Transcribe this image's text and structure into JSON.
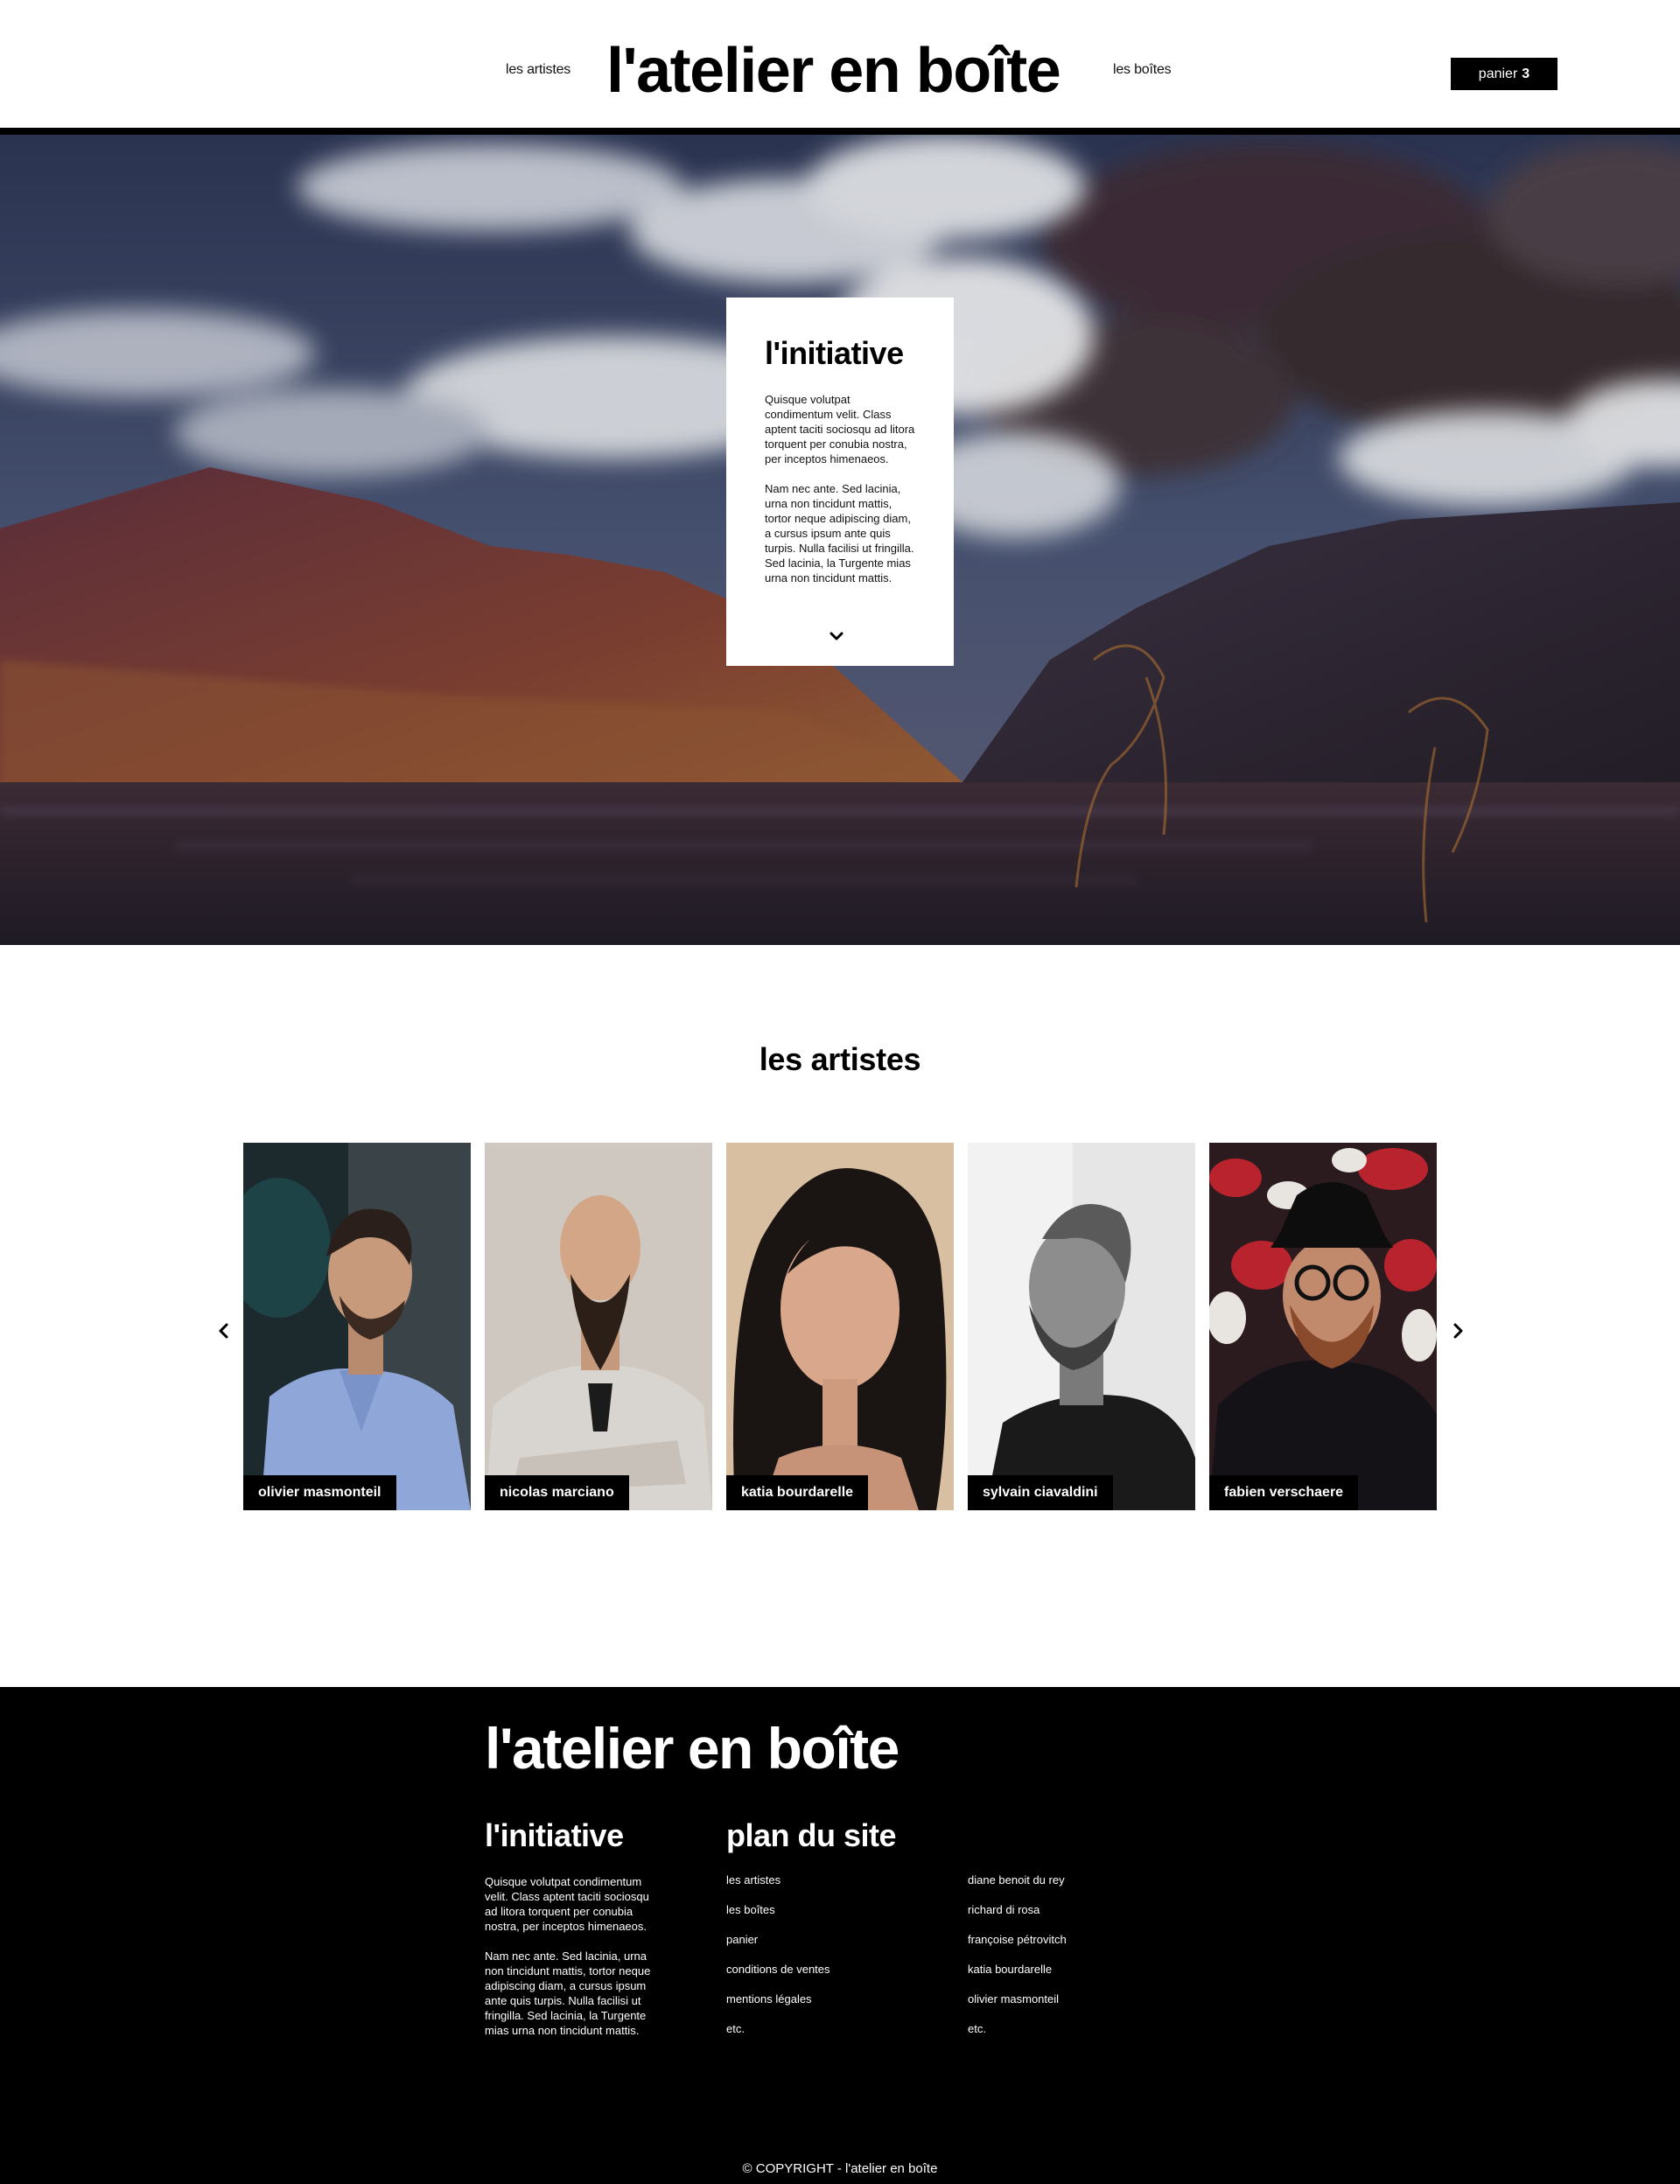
{
  "header": {
    "logo": "l'atelier en boîte",
    "nav_artistes": "les artistes",
    "nav_boites": "les boîtes",
    "cart_label": "panier",
    "cart_count": "3"
  },
  "hero": {
    "image": "landscape-painting-clouds-mountains-lake",
    "card": {
      "title": "l'initiative",
      "p1": "Quisque volutpat condimentum velit. Class aptent taciti sociosqu ad litora torquent per conubia nostra, per inceptos himenaeos.",
      "p2": "Nam nec ante. Sed lacinia, urna non tincidunt mattis, tortor neque adipiscing diam, a cursus ipsum ante quis turpis. Nulla facilisi ut fringilla. Sed lacinia, la Turgente mias urna non tincidunt mattis.",
      "scroll_icon": "chevron-down-icon"
    }
  },
  "artists": {
    "title": "les artistes",
    "prev_icon": "chevron-left-icon",
    "next_icon": "chevron-right-icon",
    "items": [
      {
        "name": "olivier masmonteil",
        "photo": "man-light-blue-shirt-profile"
      },
      {
        "name": "nicolas marciano",
        "photo": "bald-man-beard-crossed-arms"
      },
      {
        "name": "katia bourdarelle",
        "photo": "woman-dark-curly-hair"
      },
      {
        "name": "sylvain ciavaldini",
        "photo": "man-grey-beard-black-and-white"
      },
      {
        "name": "fabien verschaere",
        "photo": "man-black-hat-round-glasses"
      }
    ]
  },
  "footer": {
    "logo": "l'atelier en boîte",
    "initiative_title": "l'initiative",
    "initiative_p1": "Quisque volutpat condimentum velit. Class aptent taciti sociosqu ad litora torquent per conubia nostra, per inceptos himenaeos.",
    "initiative_p2": "Nam nec ante. Sed lacinia, urna non tincidunt mattis, tortor neque adipiscing diam, a cursus ipsum ante quis turpis. Nulla facilisi ut fringilla. Sed lacinia, la Turgente mias urna non tincidunt mattis.",
    "plan_title": "plan du site",
    "links_col1": [
      "les artistes",
      "les boîtes",
      "panier",
      "conditions de ventes",
      "mentions légales",
      "etc."
    ],
    "links_col2": [
      "diane benoit du rey",
      "richard di rosa",
      "françoise pétrovitch",
      "katia bourdarelle",
      "olivier masmonteil",
      "etc."
    ],
    "copyright": "© COPYRIGHT - l'atelier en boîte"
  }
}
